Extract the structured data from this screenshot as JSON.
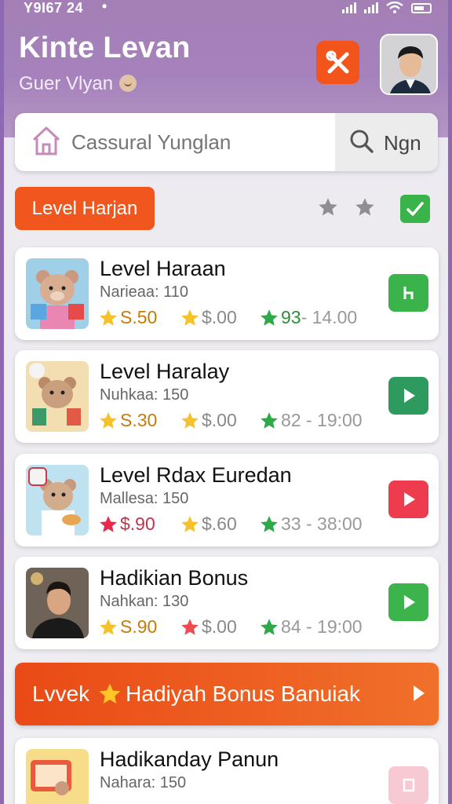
{
  "status_bar": {
    "time": "Y9I67 24",
    "dot": "•"
  },
  "header": {
    "title": "Kinte Levan",
    "subtitle": "Guer Vlyan"
  },
  "search": {
    "placeholder": "Cassural Yunglan",
    "button_label": "Ngn"
  },
  "level_tag": "Level Harjan",
  "rating": {
    "stars_shown": 2
  },
  "cards": [
    {
      "title": "Level Haraan",
      "meta": "Narieaa: 110",
      "stat_a": "S.50",
      "stat_b": "$.00",
      "stat_c_hl": "93",
      "stat_c": " - 14.00",
      "button_color": "#39b34a",
      "button_icon": "bookmark-icon"
    },
    {
      "title": "Level Haralay",
      "meta": "Nuhkaa: 150",
      "stat_a": "S.30",
      "stat_b": "$.00",
      "stat_c_hl": "",
      "stat_c": "82 - 19:00",
      "button_color": "#2e9b5e",
      "button_icon": "play-icon"
    },
    {
      "title": "Level Rdax Euredan",
      "meta": "Mallesa: 150",
      "stat_a": "$.90",
      "stat_b": "$.60",
      "stat_c_hl": "",
      "stat_c": "33 - 38:00",
      "button_color": "#ee3b4e",
      "button_icon": "play-icon"
    },
    {
      "title": "Hadikian Bonus",
      "meta": "Nahkan: 130",
      "stat_a": "S.90",
      "stat_b": "$.00",
      "stat_c_hl": "",
      "stat_c": "84 - 19:00",
      "button_color": "#3db34b",
      "button_icon": "play-icon"
    },
    {
      "title": "Hadikanday Panun",
      "meta": "Nahara: 150",
      "stat_a": "",
      "stat_b": "",
      "stat_c_hl": "",
      "stat_c": "",
      "button_color": "#f7c9d3",
      "button_icon": "bookmark-icon"
    }
  ],
  "banner": {
    "pre": "Lvvek",
    "text": "Hadiyah Bonus Banuiak"
  },
  "colors": {
    "accent": "#f0561e",
    "header": "#a47fb6",
    "green": "#39b34a",
    "red": "#ee3b4e"
  }
}
